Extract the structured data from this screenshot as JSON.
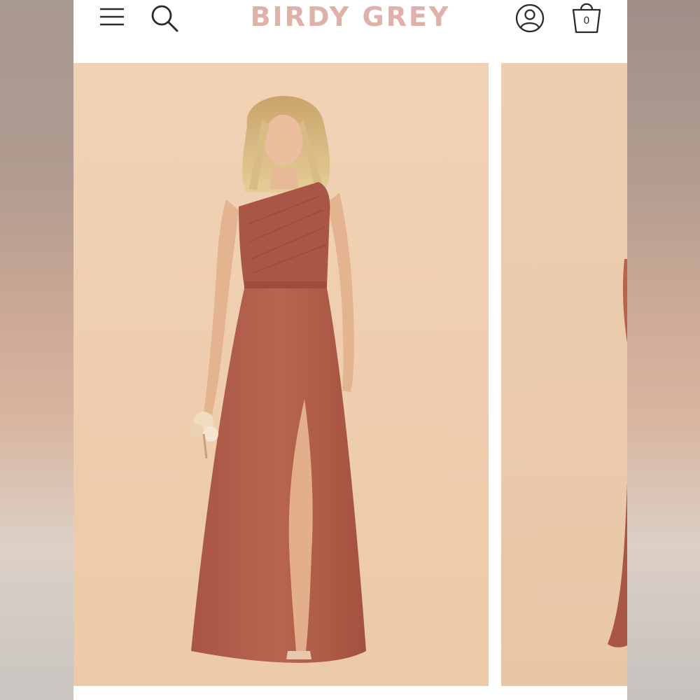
{
  "header": {
    "brand": "BIRDY GREY",
    "bag_count": "0",
    "icons": [
      "menu-icon",
      "search-icon",
      "account-icon",
      "shopping-bag-icon"
    ]
  },
  "colors": {
    "brand_text": "#e0b0aa",
    "photo_background": "#f1d3b5",
    "dress": "#b4604f"
  },
  "carousel": {
    "images": [
      "product-photo-front",
      "product-photo-next"
    ]
  }
}
